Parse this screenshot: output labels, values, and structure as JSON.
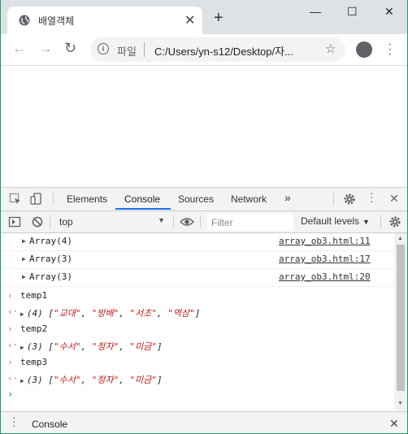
{
  "browser": {
    "tab_title": "배열객체",
    "tab_close": "✕",
    "new_tab": "+",
    "win_min": "—",
    "win_max": "☐",
    "win_close": "✕"
  },
  "address": {
    "back": "←",
    "forward": "→",
    "reload": "↻",
    "info": "i",
    "scheme_label": "파일",
    "url": "C:/Users/yn-s12/Desktop/자...",
    "star": "☆"
  },
  "devtools": {
    "tabs": [
      "Elements",
      "Console",
      "Sources",
      "Network"
    ],
    "more": "»",
    "active_tab": "Console",
    "context": "top",
    "filter_placeholder": "Filter",
    "levels": "Default levels",
    "close": "✕",
    "logs": [
      {
        "text": "Array(4)",
        "source": "array_ob3.html:11"
      },
      {
        "text": "Array(3)",
        "source": "array_ob3.html:17"
      },
      {
        "text": "Array(3)",
        "source": "array_ob3.html:20"
      }
    ],
    "entries": [
      {
        "command": "temp1",
        "result_prefix": "(4) [",
        "items": [
          "\"교대\"",
          "\"방배\"",
          "\"서초\"",
          "\"역삼\""
        ],
        "result_suffix": "]"
      },
      {
        "command": "temp2",
        "result_prefix": "(3) [",
        "items": [
          "\"수서\"",
          "\"정자\"",
          "\"미금\""
        ],
        "result_suffix": "]"
      },
      {
        "command": "temp3",
        "result_prefix": "(3) [",
        "items": [
          "\"수서\"",
          "\"정자\"",
          "\"미금\""
        ],
        "result_suffix": "]"
      }
    ],
    "input_prompt": "›",
    "drawer_label": "Console"
  },
  "colors": {
    "accent": "#1a73e8",
    "string": "#c41a16",
    "window_border": "#1e9a6b"
  }
}
